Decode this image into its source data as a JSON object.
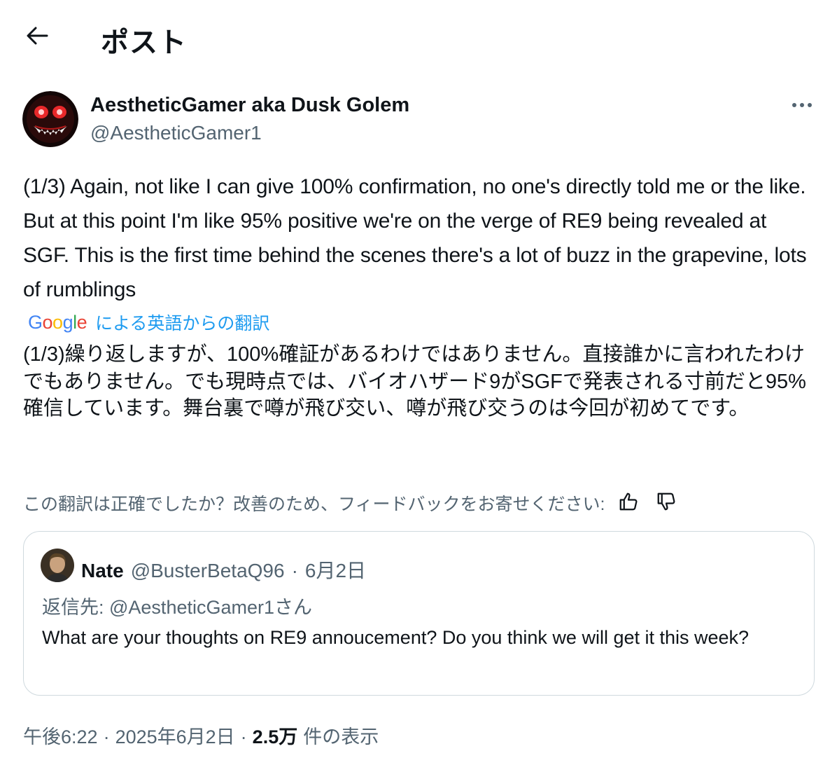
{
  "header": {
    "back_icon": "arrow-left-icon",
    "title": "ポスト"
  },
  "author": {
    "name": "AestheticGamer aka Dusk Golem",
    "handle": "@AestheticGamer1",
    "more_icon": "ellipsis-icon"
  },
  "tweet": {
    "text": "(1/3) Again, not like I can give 100% confirmation, no one's directly told me or the like. But at this point I'm like 95% positive we're on the verge of RE9 being revealed at SGF. This is the first time behind the scenes there's a lot of buzz in the grapevine, lots of rumblings"
  },
  "translation": {
    "google_letters": [
      "G",
      "o",
      "o",
      "g",
      "l",
      "e"
    ],
    "google_colors": [
      "#4285F4",
      "#EA4335",
      "#FBBC05",
      "#4285F4",
      "#34A853",
      "#EA4335"
    ],
    "label": "による英語からの翻訳",
    "text": "(1/3)繰り返しますが、100%確証があるわけではありません。直接誰かに言われたわけでもありません。でも現時点では、バイオハザード9がSGFで発表される寸前だと95%確信しています。舞台裏で噂が飛び交い、噂が飛び交うのは今回が初めてです。",
    "feedback_prompt": "この翻訳は正確でしたか？改善のため、フィードバックをお寄せください:",
    "thumbs_up_icon": "thumbs-up-icon",
    "thumbs_down_icon": "thumbs-down-icon"
  },
  "quote": {
    "name": "Nate",
    "handle": "@BusterBetaQ96",
    "separator": "·",
    "date": "6月2日",
    "reply_to": "返信先: @AestheticGamer1さん",
    "text": "What are your thoughts on RE9 annoucement? Do you think we will get it this week?"
  },
  "meta": {
    "time": "午後6:22",
    "sep1": "·",
    "date": "2025年6月2日",
    "sep2": "·",
    "views_count": "2.5万",
    "views_label": "件の表示"
  },
  "colors": {
    "text_primary": "#0f1419",
    "text_secondary": "#536471",
    "link": "#1d9bf0",
    "border": "#cfd9de"
  }
}
